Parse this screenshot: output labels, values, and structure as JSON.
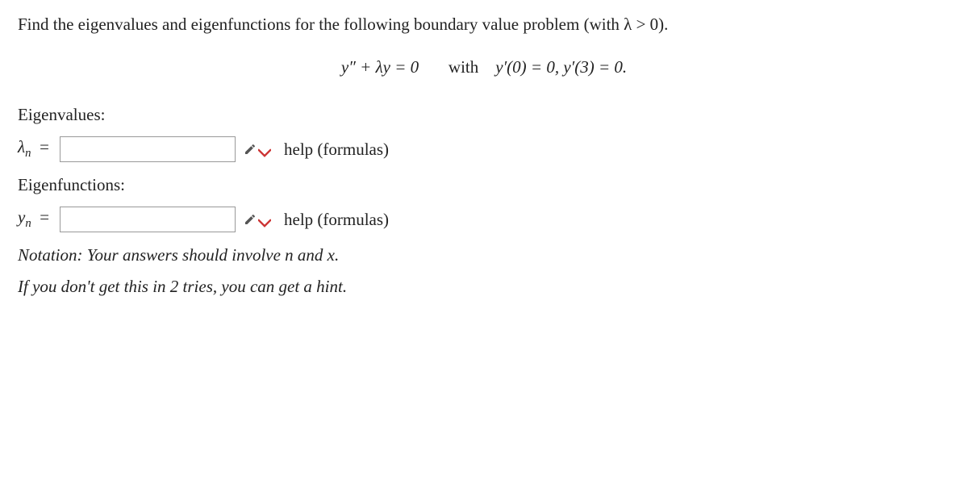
{
  "problem": "Find the eigenvalues and eigenfunctions for the following boundary value problem (with λ > 0).",
  "equation": {
    "ode": "y″ + λy = 0",
    "with": "with",
    "bc": "y′(0) = 0,   y′(3) = 0."
  },
  "sections": {
    "eigenvalues_label": "Eigenvalues:",
    "eigenfunctions_label": "Eigenfunctions:"
  },
  "inputs": {
    "lambda_prefix": "λ",
    "lambda_sub": "n",
    "lambda_eq": "=",
    "lambda_value": "",
    "y_prefix": "y",
    "y_sub": "n",
    "y_eq": "=",
    "y_value": ""
  },
  "help": {
    "text": "help (formulas)"
  },
  "notes": {
    "notation_label": "Notation:",
    "notation_text": " Your answers should involve n and x.",
    "hint_text": "If you don't get this in 2 tries, you can get a hint."
  }
}
